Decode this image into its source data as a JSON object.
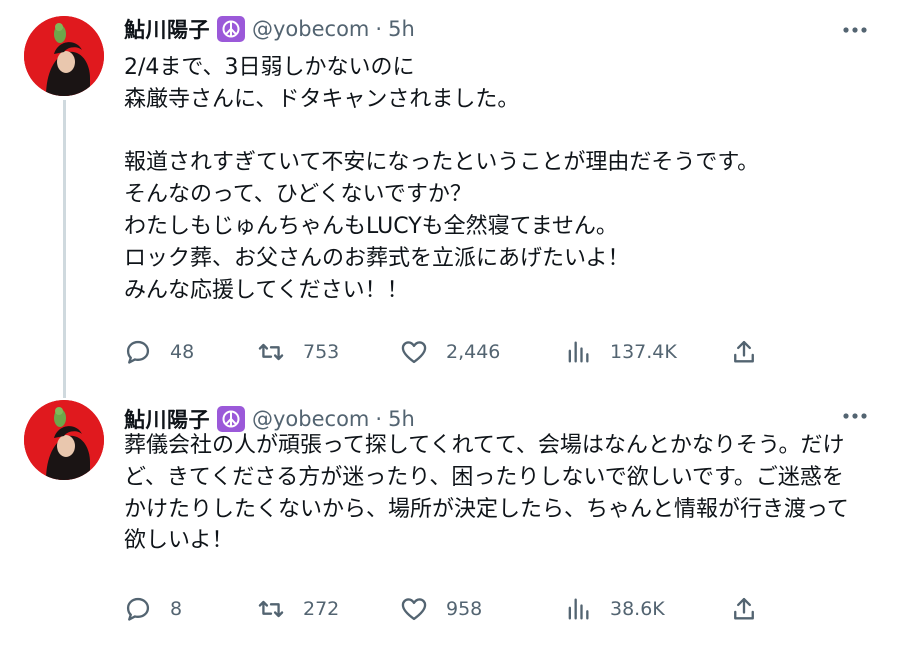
{
  "tweets": [
    {
      "author": {
        "name": "鮎川陽子",
        "handle": "@yobecom",
        "separator": "·",
        "time": "5h",
        "badge_icon": "peace-icon",
        "badge_color": "#9b59d9",
        "avatar_bg": "#e0191e"
      },
      "text": "2/4まで、3日弱しかないのに\n森厳寺さんに、ドタキャンされました。\n\n報道されすぎていて不安になったということが理由だそうです。\nそんなのって、ひどくないですか？\nわたしもじゅんちゃんもLUCYも全然寝てません。\nロック葬、お父さんのお葬式を立派にあげたいよ！\nみんな応援してください！！",
      "stats": {
        "replies": "48",
        "retweets": "753",
        "likes": "2,446",
        "views": "137.4K"
      }
    },
    {
      "author": {
        "name": "鮎川陽子",
        "handle": "@yobecom",
        "separator": "·",
        "time": "5h",
        "badge_icon": "peace-icon",
        "badge_color": "#9b59d9",
        "avatar_bg": "#e0191e"
      },
      "text": "葬儀会社の人が頑張って探してくれてて、会場はなんとかなりそう。だけど、きてくださる方が迷ったり、困ったりしないで欲しいです。ご迷惑をかけたりしたくないから、場所が決定したら、ちゃんと情報が行き渡って欲しいよ！",
      "stats": {
        "replies": "8",
        "retweets": "272",
        "likes": "958",
        "views": "38.6K"
      }
    }
  ],
  "colors": {
    "text_primary": "#0f1419",
    "text_secondary": "#536471",
    "thread_line": "#cfd9de"
  }
}
